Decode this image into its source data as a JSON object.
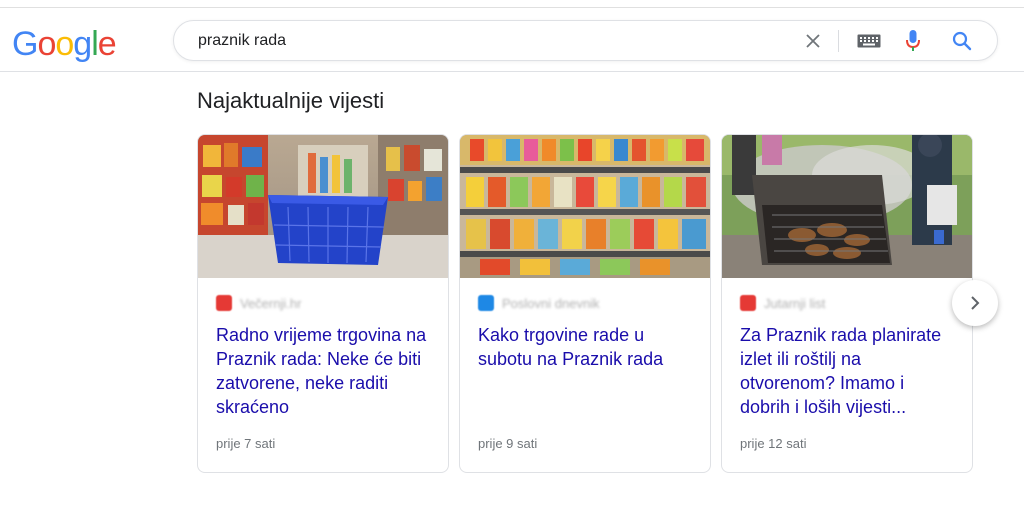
{
  "search": {
    "query": "praznik rada"
  },
  "logo": {
    "letters": [
      "G",
      "o",
      "o",
      "g",
      "l",
      "e"
    ],
    "colors": [
      "#4285F4",
      "#EA4335",
      "#FBBC05",
      "#4285F4",
      "#34A853",
      "#EA4335"
    ]
  },
  "section": {
    "title": "Najaktualnije vijesti"
  },
  "cards": [
    {
      "source": "Večernji.hr",
      "favicon_color": "#e53935",
      "title": "Radno vrijeme trgovina na Praznik rada: Neke će biti zatvorene, neke raditi skraćeno",
      "time": "prije 7 sati"
    },
    {
      "source": "Poslovni dnevnik",
      "favicon_color": "#1e88e5",
      "title": "Kako trgovine rade u subotu na Praznik rada",
      "time": "prije 9 sati"
    },
    {
      "source": "Jutarnji list",
      "favicon_color": "#e53935",
      "title": "Za Praznik rada planirate izlet ili roštilj na otvorenom? Imamo i dobrih i loših vijesti...",
      "time": "prije 12 sati"
    }
  ],
  "colors": {
    "link": "#1a0dab",
    "meta": "#70757a",
    "search_blue": "#4285F4"
  }
}
